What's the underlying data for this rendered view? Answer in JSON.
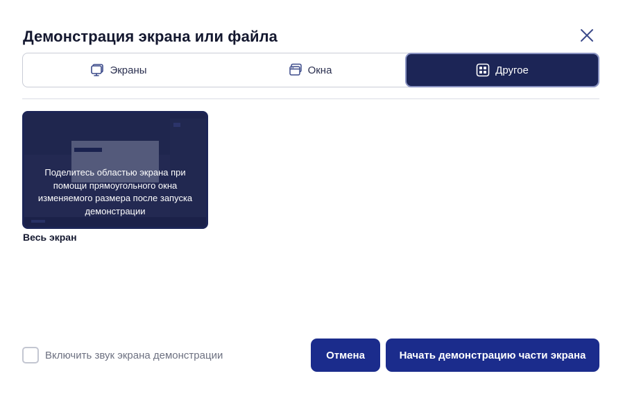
{
  "dialog": {
    "title": "Демонстрация экрана или файла"
  },
  "tabs": [
    {
      "label": "Экраны",
      "icon": "monitor-icon",
      "active": false
    },
    {
      "label": "Окна",
      "icon": "window-icon",
      "active": false
    },
    {
      "label": "Другое",
      "icon": "grid-icon",
      "active": true
    }
  ],
  "thumbnail": {
    "caption": "Поделитесь областью экрана при помощи прямоугольного окна изменяемого размера после запуска демонстрации",
    "label": "Весь экран"
  },
  "audio_option": {
    "label": "Включить звук экрана демонстрации",
    "checked": false
  },
  "buttons": {
    "cancel": "Отмена",
    "start": "Начать демонстрацию части экрана"
  },
  "colors": {
    "accent": "#1b2c8c",
    "active_tab": "#1c2556",
    "title": "#14182f"
  }
}
